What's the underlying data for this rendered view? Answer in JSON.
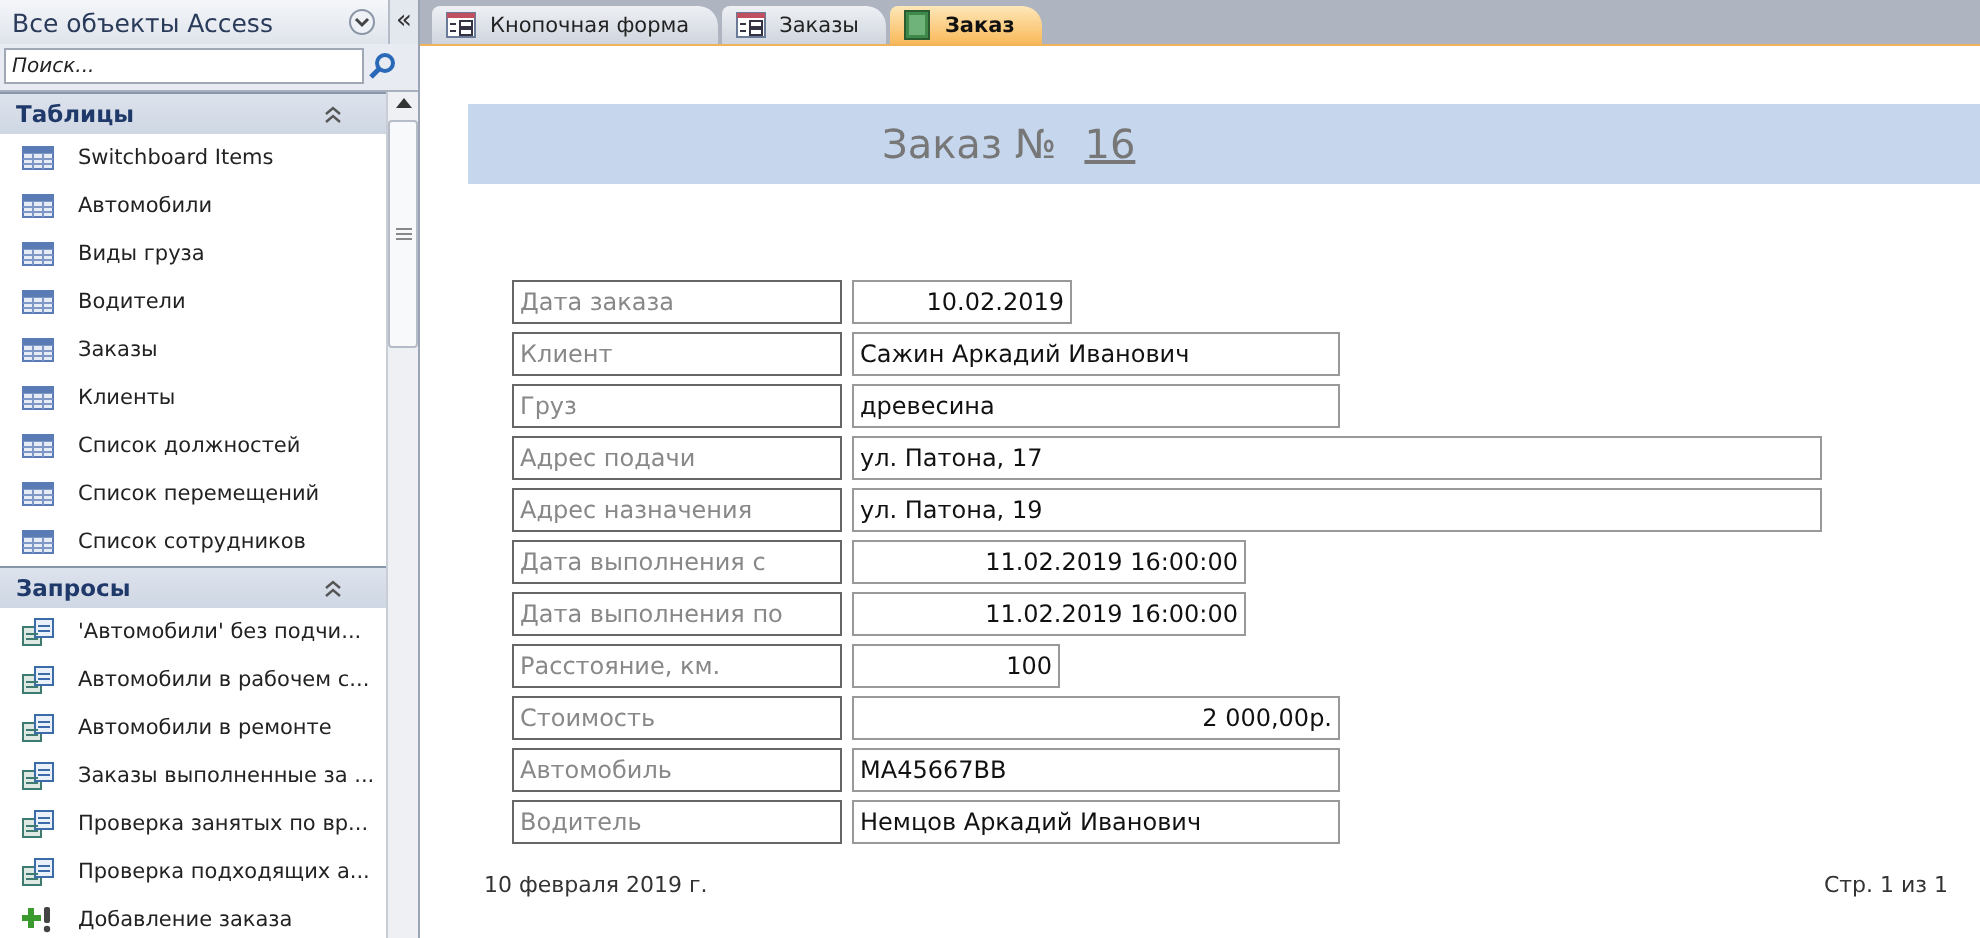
{
  "nav": {
    "title": "Все объекты Access",
    "collapse": "«",
    "search": {
      "placeholder": "Поиск..."
    },
    "groups": [
      {
        "title": "Таблицы",
        "expanded": true,
        "items": [
          {
            "label": "Switchboard Items",
            "kind": "table"
          },
          {
            "label": "Автомобили",
            "kind": "table"
          },
          {
            "label": "Виды груза",
            "kind": "table"
          },
          {
            "label": "Водители",
            "kind": "table"
          },
          {
            "label": "Заказы",
            "kind": "table"
          },
          {
            "label": "Клиенты",
            "kind": "table"
          },
          {
            "label": "Список должностей",
            "kind": "table"
          },
          {
            "label": "Список перемещений",
            "kind": "table"
          },
          {
            "label": "Список сотрудников",
            "kind": "table"
          }
        ]
      },
      {
        "title": "Запросы",
        "expanded": true,
        "items": [
          {
            "label": "'Автомобили' без подчи...",
            "kind": "query"
          },
          {
            "label": "Автомобили в рабочем с...",
            "kind": "query"
          },
          {
            "label": "Автомобили в ремонте",
            "kind": "query"
          },
          {
            "label": "Заказы выполненные за ...",
            "kind": "query"
          },
          {
            "label": "Проверка занятых по вр...",
            "kind": "query"
          },
          {
            "label": "Проверка подходящих а...",
            "kind": "query"
          },
          {
            "label": "Добавление заказа",
            "kind": "append"
          }
        ]
      }
    ]
  },
  "tabs": [
    {
      "label": "Кнопочная форма",
      "kind": "form",
      "selected": false
    },
    {
      "label": "Заказы",
      "kind": "form",
      "selected": false
    },
    {
      "label": "Заказ",
      "kind": "report",
      "selected": true
    }
  ],
  "report": {
    "title": "Заказ №",
    "number": "16",
    "fields": [
      {
        "label": "Дата заказа",
        "value": "10.02.2019",
        "kind": "date"
      },
      {
        "label": "Клиент",
        "value": "Сажин Аркадий Иванович",
        "kind": "text"
      },
      {
        "label": "Груз",
        "value": "древесина",
        "kind": "text"
      },
      {
        "label": "Адрес подачи",
        "value": "ул. Патона, 17",
        "kind": "address"
      },
      {
        "label": "Адрес назначения",
        "value": "ул. Патона, 19",
        "kind": "address"
      },
      {
        "label": "Дата выполнения с",
        "value": "11.02.2019 16:00:00",
        "kind": "datetime"
      },
      {
        "label": "Дата выполнения по",
        "value": "11.02.2019 16:00:00",
        "kind": "datetime"
      },
      {
        "label": "Расстояние, км.",
        "value": "100",
        "kind": "number"
      },
      {
        "label": "Стоимость",
        "value": "2 000,00р.",
        "kind": "money"
      },
      {
        "label": "Автомобиль",
        "value": "МА45667ВВ",
        "kind": "text"
      },
      {
        "label": "Водитель",
        "value": "Немцов Аркадий Иванович",
        "kind": "text"
      }
    ],
    "footer_date": "10 февраля 2019 г.",
    "page": "Стр. 1 из 1"
  }
}
